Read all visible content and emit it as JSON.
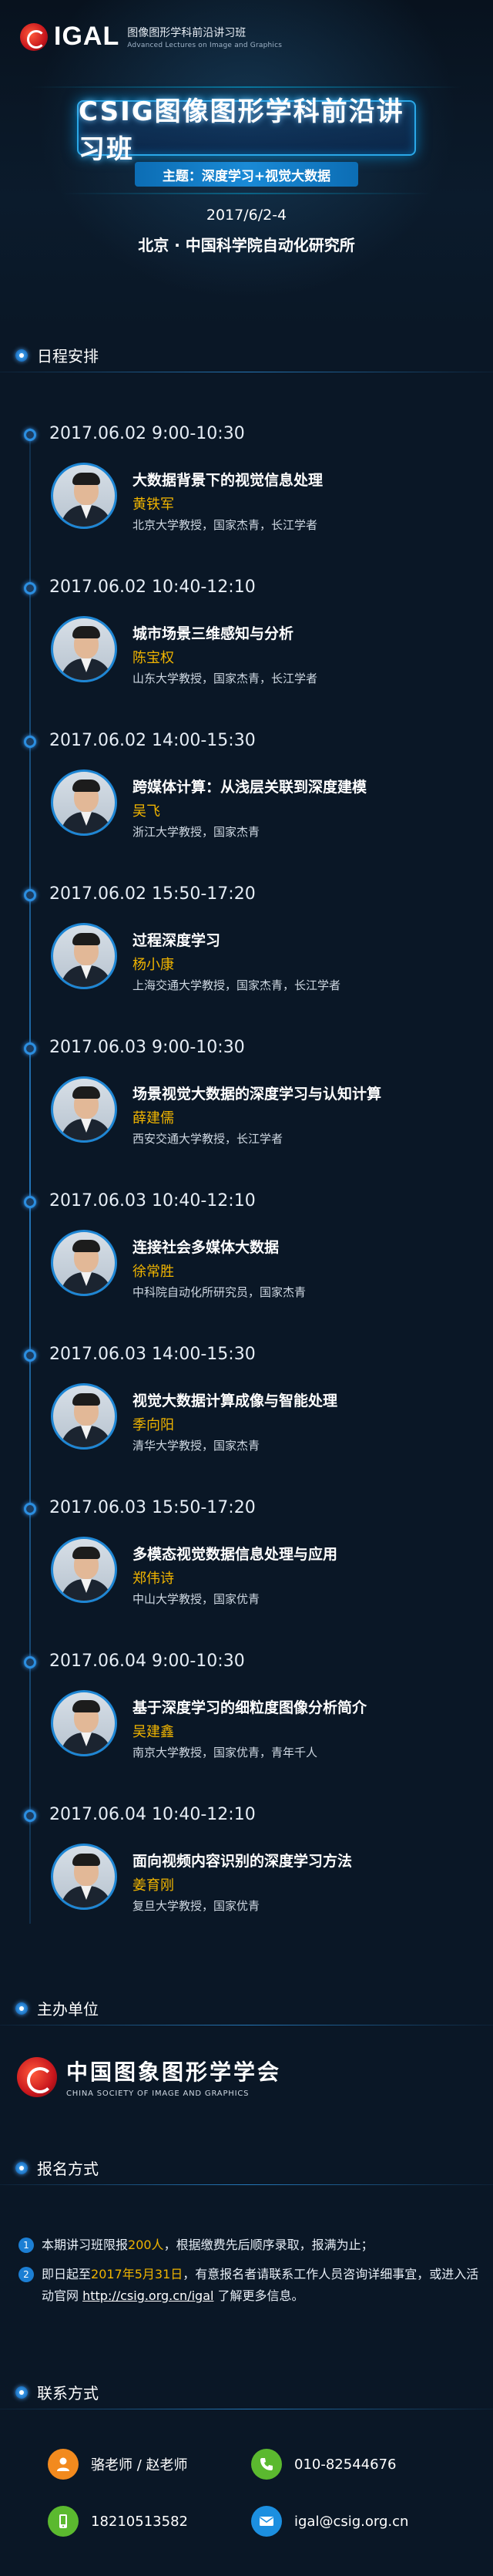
{
  "header": {
    "logo_text": "IGAL",
    "logo_sub_cn": "图像图形学科前沿讲习班",
    "logo_sub_en": "Advanced Lectures on Image and Graphics",
    "main_title": "CSIG图像图形学科前沿讲习班",
    "subject": "主题：深度学习+视觉大数据",
    "date": "2017/6/2-4",
    "location": "北京 · 中国科学院自动化研究所"
  },
  "schedule": {
    "section_title": "日程安排",
    "sessions": [
      {
        "time": "2017.06.02  9:00-10:30",
        "talk": "大数据背景下的视觉信息处理",
        "speaker": "黄铁军",
        "desc": "北京大学教授，国家杰青，长江学者"
      },
      {
        "time": "2017.06.02  10:40-12:10",
        "talk": "城市场景三维感知与分析",
        "speaker": "陈宝权",
        "desc": "山东大学教授，国家杰青，长江学者"
      },
      {
        "time": "2017.06.02  14:00-15:30",
        "talk": "跨媒体计算：从浅层关联到深度建模",
        "speaker": "吴飞",
        "desc": "浙江大学教授，国家杰青"
      },
      {
        "time": "2017.06.02  15:50-17:20",
        "talk": "过程深度学习",
        "speaker": "杨小康",
        "desc": "上海交通大学教授，国家杰青，长江学者"
      },
      {
        "time": "2017.06.03  9:00-10:30",
        "talk": "场景视觉大数据的深度学习与认知计算",
        "speaker": "薛建儒",
        "desc": "西安交通大学教授，长江学者"
      },
      {
        "time": "2017.06.03  10:40-12:10",
        "talk": "连接社会多媒体大数据",
        "speaker": "徐常胜",
        "desc": "中科院自动化所研究员，国家杰青"
      },
      {
        "time": "2017.06.03  14:00-15:30",
        "talk": "视觉大数据计算成像与智能处理",
        "speaker": "季向阳",
        "desc": "清华大学教授，国家杰青"
      },
      {
        "time": "2017.06.03  15:50-17:20",
        "talk": "多模态视觉数据信息处理与应用",
        "speaker": "郑伟诗",
        "desc": "中山大学教授，国家优青"
      },
      {
        "time": "2017.06.04  9:00-10:30",
        "talk": "基于深度学习的细粒度图像分析简介",
        "speaker": "吴建鑫",
        "desc": "南京大学教授，国家优青，青年千人"
      },
      {
        "time": "2017.06.04  10:40-12:10",
        "talk": "面向视频内容识别的深度学习方法",
        "speaker": "姜育刚",
        "desc": "复旦大学教授，国家优青"
      }
    ]
  },
  "organizer": {
    "section_title": "主办单位",
    "name_cn": "中国图象图形学学会",
    "name_en": "CHINA SOCIETY OF IMAGE AND GRAPHICS"
  },
  "registration": {
    "section_title": "报名方式",
    "items": [
      {
        "num": "1",
        "pre": "本期讲习班限报",
        "highlight": "200人",
        "post": "，根据缴费先后顺序录取，报满为止；"
      },
      {
        "num": "2",
        "pre": "即日起至",
        "highlight": "2017年5月31日",
        "mid": "，有意报名者请联系工作人员咨询详细事宜，或进入活动官网 ",
        "link": "http://csig.org.cn/igal",
        "post": " 了解更多信息。"
      }
    ]
  },
  "contact": {
    "section_title": "联系方式",
    "person": "骆老师 / 赵老师",
    "phone": "010-82544676",
    "mobile": "18210513582",
    "email": "igal@csig.org.cn"
  },
  "colors": {
    "background": "#0a1726",
    "accent_blue": "#2b8ee0",
    "speaker_yellow": "#f0b400",
    "contact_orange": "#f28a1e",
    "contact_green": "#5bb92f",
    "contact_blue": "#1c8fe0"
  }
}
